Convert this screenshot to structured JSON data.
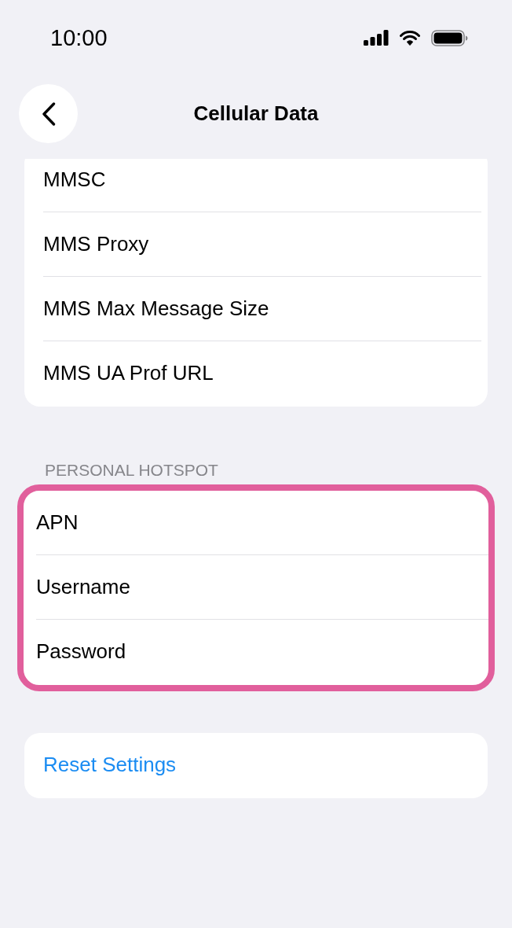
{
  "status_bar": {
    "time": "10:00"
  },
  "nav": {
    "title": "Cellular Data"
  },
  "sections": [
    {
      "highlighted": false,
      "rows": [
        {
          "kind": "setting",
          "label": "MMSC"
        },
        {
          "kind": "setting",
          "label": "MMS Proxy"
        },
        {
          "kind": "setting",
          "label": "MMS Max Message Size"
        },
        {
          "kind": "setting",
          "label": "MMS UA Prof URL"
        }
      ]
    },
    {
      "header": "PERSONAL HOTSPOT",
      "highlighted": true,
      "rows": [
        {
          "kind": "setting",
          "label": "APN"
        },
        {
          "kind": "setting",
          "label": "Username"
        },
        {
          "kind": "setting",
          "label": "Password"
        }
      ]
    },
    {
      "highlighted": false,
      "rows": [
        {
          "kind": "action",
          "label": "Reset Settings"
        }
      ]
    }
  ]
}
